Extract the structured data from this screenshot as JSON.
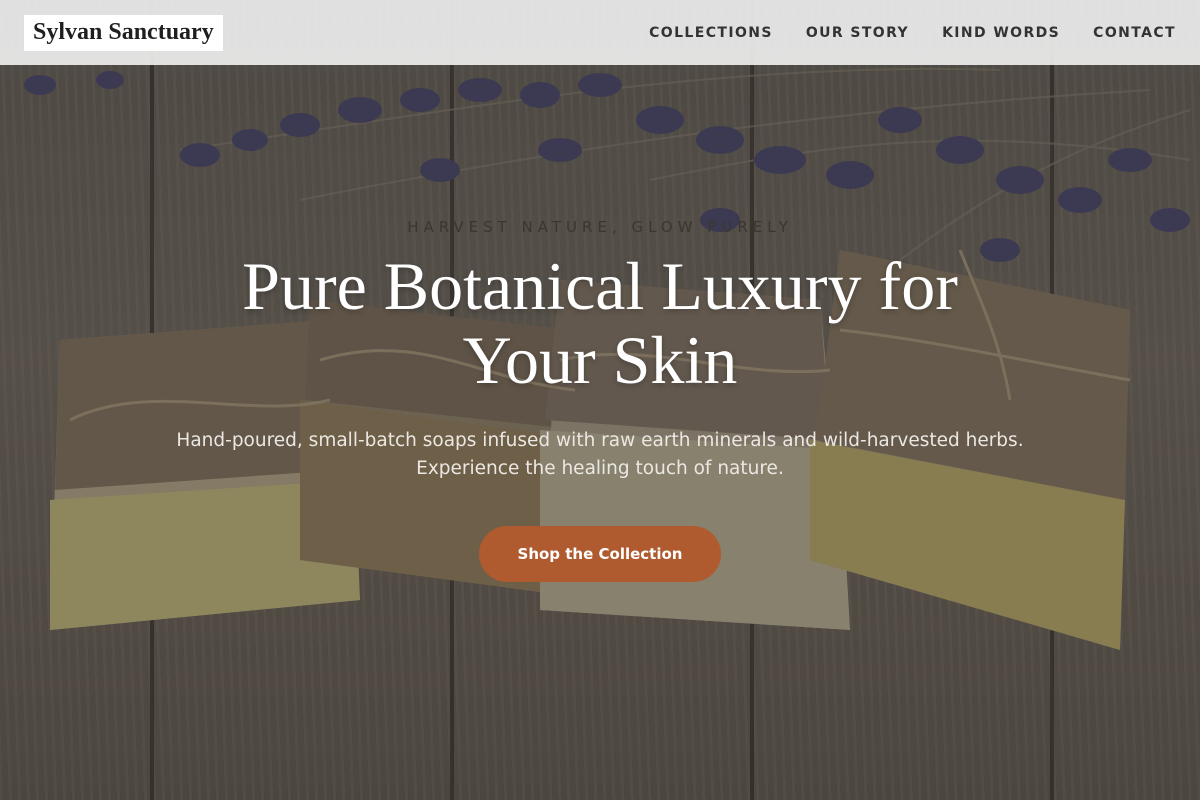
{
  "brand": {
    "name": "Sylvan Sanctuary"
  },
  "nav": {
    "items": [
      {
        "label": "COLLECTIONS"
      },
      {
        "label": "OUR STORY"
      },
      {
        "label": "KIND WORDS"
      },
      {
        "label": "CONTACT"
      }
    ]
  },
  "hero": {
    "eyebrow": "HARVEST NATURE, GLOW PURELY",
    "headline": "Pure Botanical Luxury for Your Skin",
    "subhead": "Hand-poured, small-batch soaps infused with raw earth minerals and wild-harvested herbs. Experience the healing touch of nature.",
    "cta_label": "Shop the Collection",
    "image_subject": "handmade soap bars wrapped in kraft paper and twine with dried lavender on wooden boards"
  },
  "colors": {
    "accent": "#b05a30",
    "nav_background": "#eeeeee",
    "headline": "#ffffff"
  }
}
